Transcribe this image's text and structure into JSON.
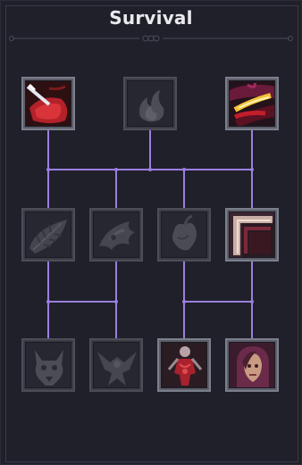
{
  "panel": {
    "title": "Survival"
  },
  "colors": {
    "background": "#1f2029",
    "connector": "#9b7fe0",
    "locked_icon": "#4a4b52",
    "active_red": "#c21e2a"
  },
  "skills": [
    {
      "row": 1,
      "col": 1,
      "icon": "bloody-slash-icon",
      "state": "unlocked"
    },
    {
      "row": 1,
      "col": 2,
      "icon": "flame-icon",
      "state": "locked"
    },
    {
      "row": 1,
      "col": 3,
      "icon": "fiery-slash-icon",
      "state": "unlocked"
    },
    {
      "row": 2,
      "col": 1,
      "icon": "leaf-icon",
      "state": "locked"
    },
    {
      "row": 2,
      "col": 2,
      "icon": "wing-icon",
      "state": "locked"
    },
    {
      "row": 2,
      "col": 3,
      "icon": "heart-icon",
      "state": "locked"
    },
    {
      "row": 2,
      "col": 4,
      "icon": "armor-plate-icon",
      "state": "unlocked"
    },
    {
      "row": 3,
      "col": 1,
      "icon": "beast-skull-icon",
      "state": "locked"
    },
    {
      "row": 3,
      "col": 2,
      "icon": "demon-icon",
      "state": "locked"
    },
    {
      "row": 3,
      "col": 3,
      "icon": "bleeding-figure-icon",
      "state": "unlocked"
    },
    {
      "row": 3,
      "col": 4,
      "icon": "hooded-face-icon",
      "state": "unlocked"
    }
  ]
}
